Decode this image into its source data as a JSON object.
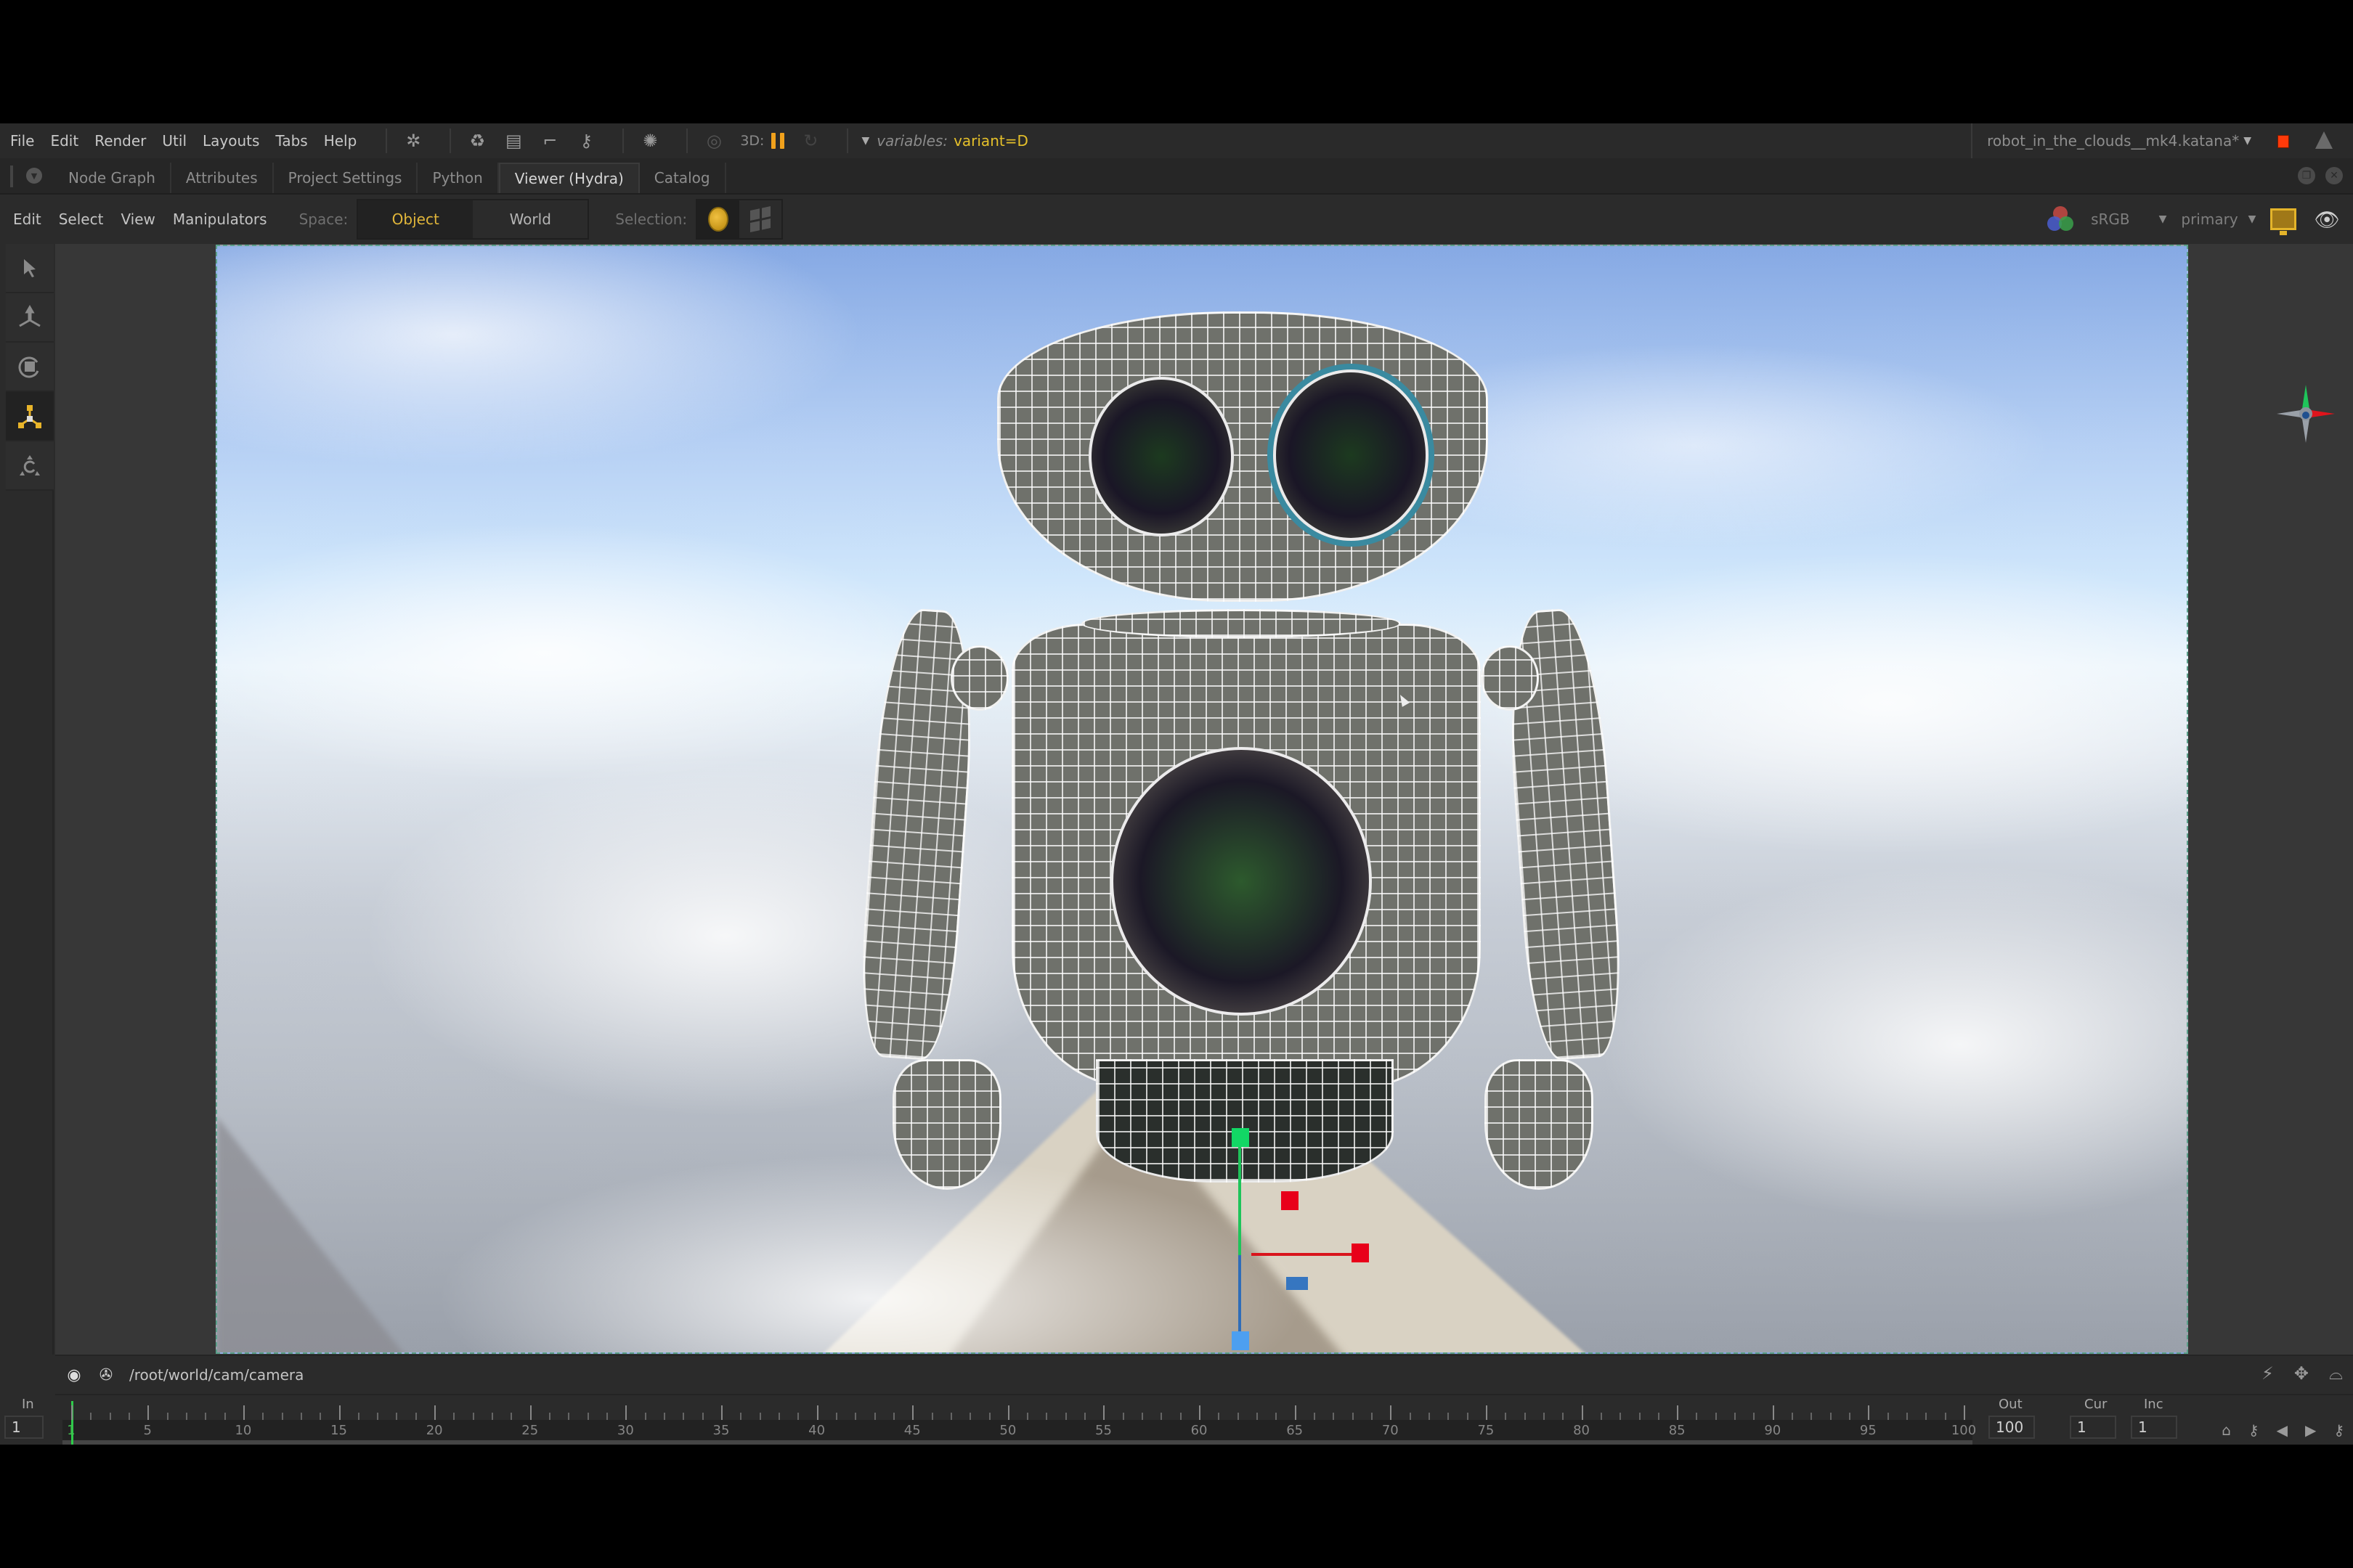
{
  "menubar": {
    "items": [
      "File",
      "Edit",
      "Render",
      "Util",
      "Layouts",
      "Tabs",
      "Help"
    ],
    "icons": [
      "settings-gear-icon",
      "recycle-icon",
      "clapper-icon",
      "pipe-icon",
      "key-icon",
      "render-filter-icon",
      "viewer-sync-icon"
    ],
    "label_3d": "3D:",
    "pause_color": "#f0a11c",
    "variables_label": "variables:",
    "variables_value": "variant=D",
    "project_name": "robot_in_the_clouds__mk4.katana*",
    "record_color": "#ff3a0a"
  },
  "tabs": {
    "items": [
      {
        "label": "Node Graph",
        "active": false
      },
      {
        "label": "Attributes",
        "active": false
      },
      {
        "label": "Project Settings",
        "active": false
      },
      {
        "label": "Python",
        "active": false
      },
      {
        "label": "Viewer (Hydra)",
        "active": true
      },
      {
        "label": "Catalog",
        "active": false
      }
    ]
  },
  "viewer_toolbar": {
    "menus": [
      "Edit",
      "Select",
      "View",
      "Manipulators"
    ],
    "space_label": "Space:",
    "space_options": [
      {
        "label": "Object",
        "selected": true
      },
      {
        "label": "World",
        "selected": false
      }
    ],
    "selection_label": "Selection:",
    "selection_modes": [
      {
        "name": "object-selection",
        "selected": true
      },
      {
        "name": "face-selection",
        "selected": false
      }
    ],
    "colorspace": "sRGB",
    "display": "primary",
    "accent_color": "#e1b63a"
  },
  "tools": [
    {
      "name": "select-tool",
      "active": false
    },
    {
      "name": "translate-tool",
      "active": false
    },
    {
      "name": "rotate-tool",
      "active": false
    },
    {
      "name": "scale-tool",
      "active": true
    },
    {
      "name": "transform-tool",
      "active": false
    }
  ],
  "manipulator": {
    "x_color": "#e8001a",
    "y_color": "#12d865",
    "z_color": "#4d9ff0"
  },
  "status": {
    "camera_path": "/root/world/cam/camera"
  },
  "timeline": {
    "in_label": "In",
    "in_value": "1",
    "out_label": "Out",
    "out_value": "100",
    "cur_label": "Cur",
    "cur_value": "1",
    "inc_label": "Inc",
    "inc_value": "1",
    "start": 1,
    "end": 100,
    "current": 1,
    "tick_labels": [
      "1",
      "5",
      "10",
      "15",
      "20",
      "25",
      "30",
      "35",
      "40",
      "45",
      "50",
      "55",
      "60",
      "65",
      "70",
      "75",
      "80",
      "85",
      "90",
      "95",
      "100"
    ]
  }
}
